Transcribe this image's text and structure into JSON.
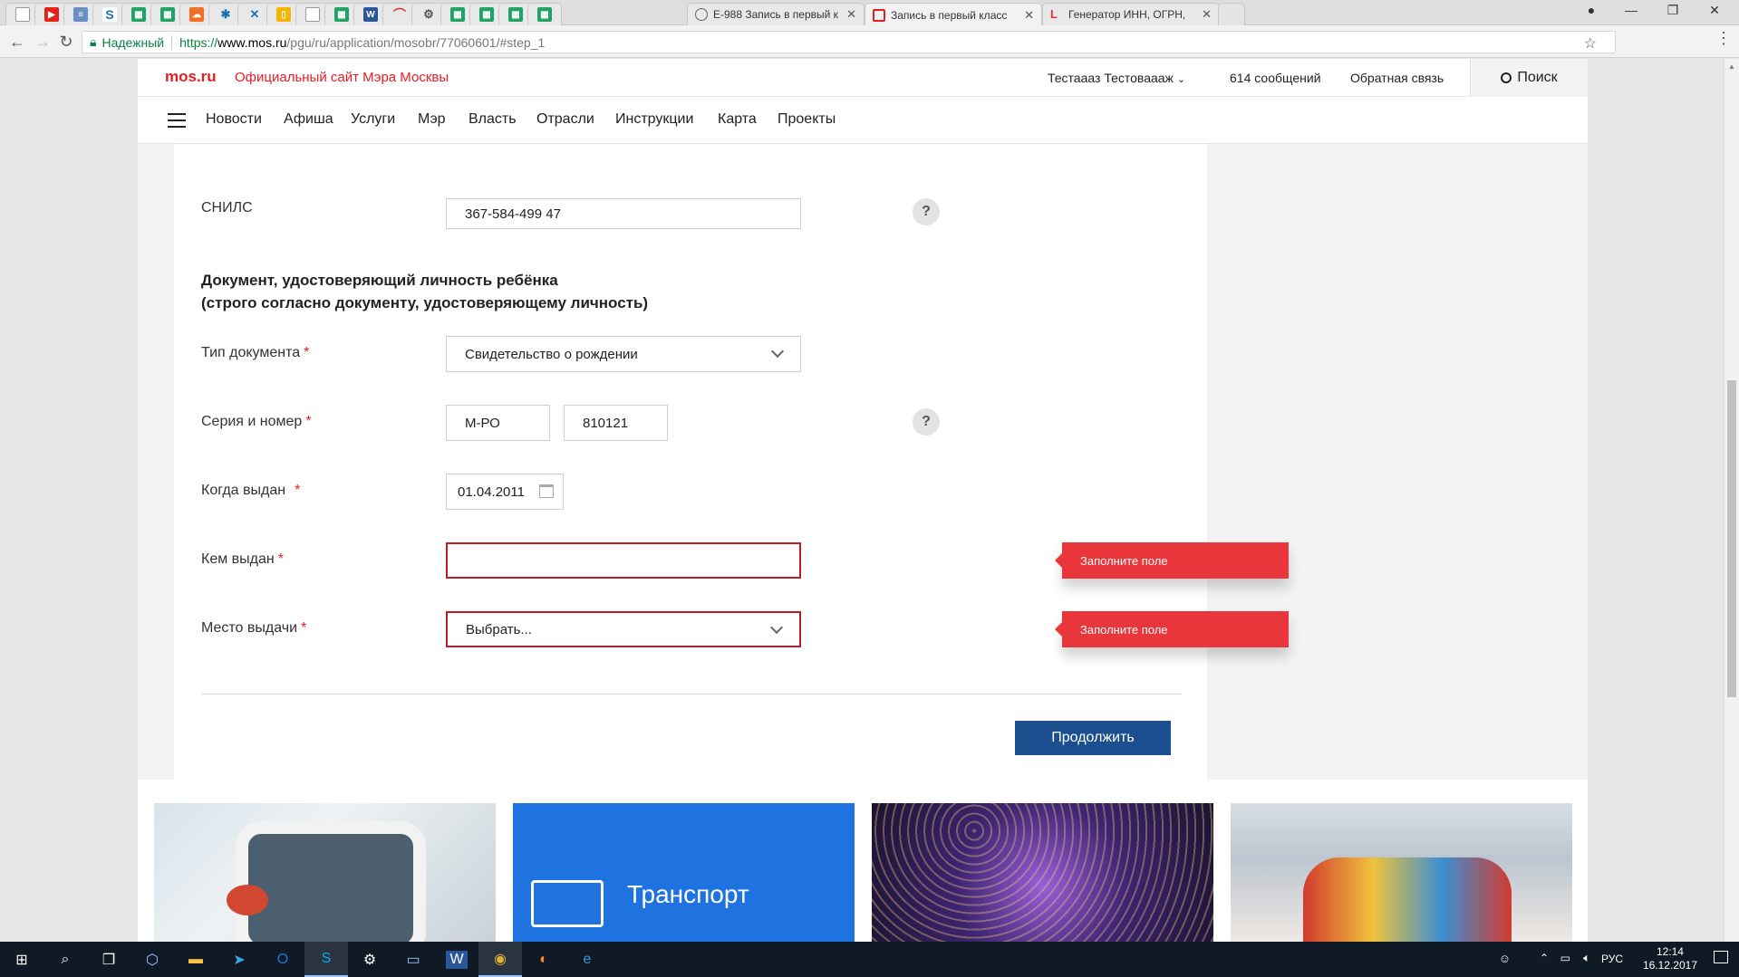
{
  "browser": {
    "tabs": [
      {
        "title": "E-988 Запись в первый к",
        "icon": "page-icon"
      },
      {
        "title": "Запись в первый класс",
        "icon": "mos-icon",
        "active": true
      },
      {
        "title": "Генератор ИНН, ОГРН,",
        "icon": "generator-icon"
      }
    ],
    "omnibox": {
      "secure_label": "Надежный",
      "url_scheme": "https://",
      "url_host": "www.mos.ru",
      "url_path": "/pgu/ru/application/mosobr/77060601/#step_1"
    }
  },
  "site": {
    "logo": "mos.ru",
    "title": "Официальный сайт Мэра Москвы",
    "user_name": "Тестаааз Тестоваааж",
    "messages": "614 сообщений",
    "feedback": "Обратная связь",
    "search_label": "Поиск",
    "nav": [
      "Новости",
      "Афиша",
      "Услуги",
      "Мэр",
      "Власть",
      "Отрасли",
      "Инструкции",
      "Карта",
      "Проекты"
    ]
  },
  "form": {
    "snils_label": "СНИЛС",
    "snils_value": "367-584-499 47",
    "section_title_1": "Документ, удостоверяющий личность ребёнка",
    "section_title_2": "(строго согласно документу, удостоверяющему личность)",
    "doc_type_label": "Тип документа",
    "doc_type_value": "Свидетельство о рождении",
    "series_label": "Серия и номер",
    "series_value": "М-РО",
    "number_value": "810121",
    "issue_date_label": "Когда выдан",
    "issue_date_value": "01.04.2011",
    "issued_by_label": "Кем выдан",
    "issued_by_value": "",
    "issue_place_label": "Место выдачи",
    "issue_place_value": "Выбрать...",
    "required_mark": "*",
    "help_mark": "?",
    "error_text": "Заполните поле",
    "continue_label": "Продолжить"
  },
  "tiles": [
    {
      "name": "metro"
    },
    {
      "name": "transport",
      "label": "Транспорт"
    },
    {
      "name": "festival"
    },
    {
      "name": "winter"
    }
  ],
  "taskbar": {
    "lang": "РУС",
    "time": "12:14",
    "date": "16.12.2017"
  },
  "colors": {
    "brand_red": "#e41e25",
    "error_red": "#e8363b",
    "primary_button": "#1c4f8f",
    "transport_tile": "#1f73e0"
  }
}
